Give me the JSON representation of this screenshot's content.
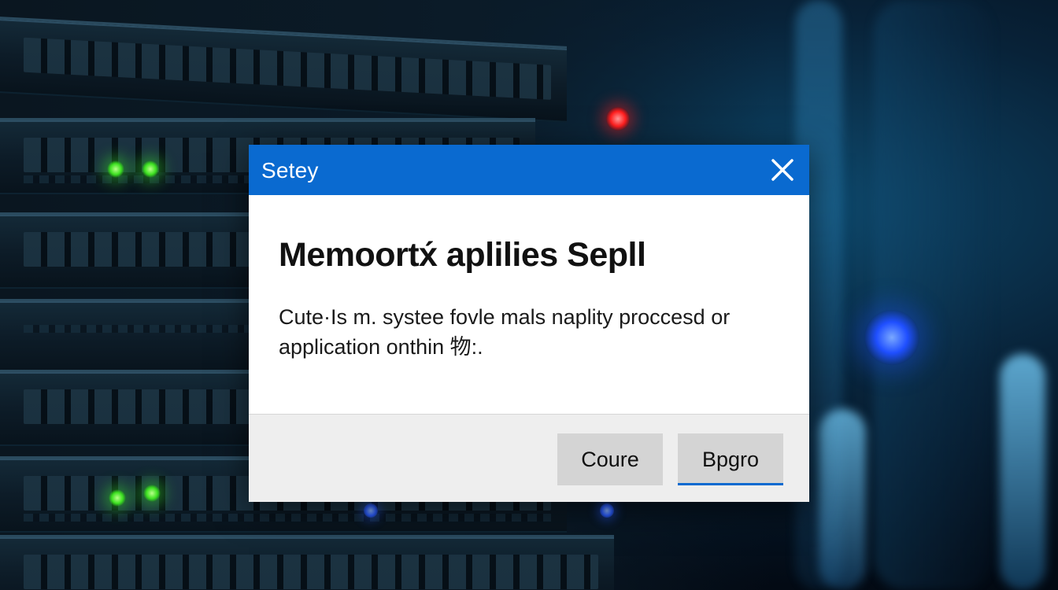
{
  "dialog": {
    "title": "Setey",
    "heading": "Memoortx́ aplilies Sepll",
    "message": "Cute·Is m. systee fovle mals naplity proccesd or application onthin 物:.",
    "buttons": {
      "first_label": "Coure",
      "second_label": "Bpgro"
    },
    "close_icon": "close-icon"
  },
  "colors": {
    "titlebar": "#0a6ad0",
    "dialog_background": "#ffffff",
    "footer_background": "#eeeeee",
    "button_background": "#d4d4d4",
    "focus_underline": "#0a6ad0",
    "background_scene": "#082238"
  },
  "background": {
    "indicator_lights": [
      "green",
      "green",
      "green",
      "green",
      "red",
      "blue"
    ]
  }
}
